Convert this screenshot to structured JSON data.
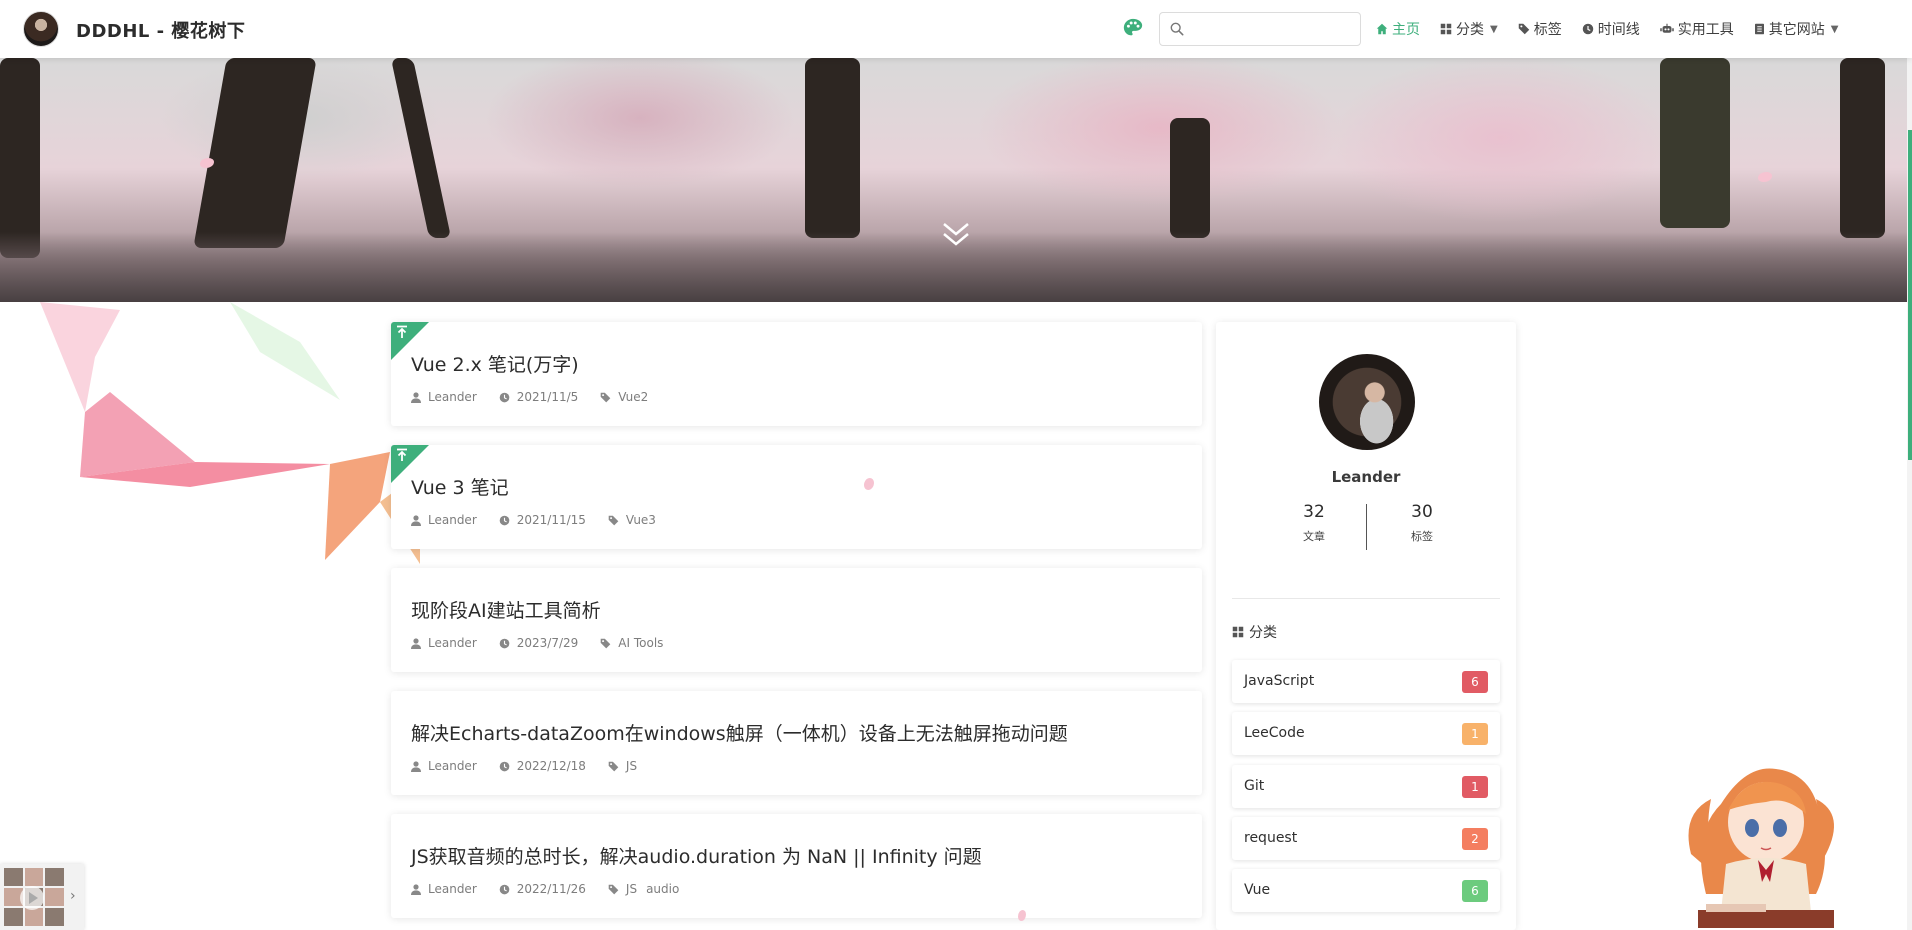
{
  "header": {
    "site_title": "DDDHL - 樱花树下",
    "search": {
      "value": "",
      "placeholder": ""
    },
    "nav": [
      {
        "label": "主页",
        "icon": "home-icon",
        "active": true
      },
      {
        "label": "分类",
        "icon": "grid-icon",
        "has_dropdown": true
      },
      {
        "label": "标签",
        "icon": "tag-icon"
      },
      {
        "label": "时间线",
        "icon": "clock-icon"
      },
      {
        "label": "实用工具",
        "icon": "robot-icon"
      },
      {
        "label": "其它网站",
        "icon": "book-icon",
        "has_dropdown": true
      }
    ]
  },
  "posts": [
    {
      "title": "Vue 2.x 笔记(万字)",
      "author": "Leander",
      "date": "2021/11/5",
      "tags": [
        "Vue2"
      ],
      "sticky": true
    },
    {
      "title": "Vue 3 笔记",
      "author": "Leander",
      "date": "2021/11/15",
      "tags": [
        "Vue3"
      ],
      "sticky": true
    },
    {
      "title": "现阶段AI建站工具简析",
      "author": "Leander",
      "date": "2023/7/29",
      "tags": [
        "AI Tools"
      ],
      "sticky": false
    },
    {
      "title": "解决Echarts-dataZoom在windows触屏（一体机）设备上无法触屏拖动问题",
      "author": "Leander",
      "date": "2022/12/18",
      "tags": [
        "JS"
      ],
      "sticky": false
    },
    {
      "title": "JS获取音频的总时长，解决audio.duration 为 NaN || Infinity 问题",
      "author": "Leander",
      "date": "2022/11/26",
      "tags": [
        "JS",
        "audio"
      ],
      "sticky": false
    }
  ],
  "sidebar": {
    "name": "Leander",
    "stats": [
      {
        "value": "32",
        "label": "文章"
      },
      {
        "value": "30",
        "label": "标签"
      }
    ],
    "categories_title": "分类",
    "categories": [
      {
        "name": "JavaScript",
        "count": "6",
        "color": "#e15b64"
      },
      {
        "name": "LeeCode",
        "count": "1",
        "color": "#f8b26a"
      },
      {
        "name": "Git",
        "count": "1",
        "color": "#e15b64"
      },
      {
        "name": "request",
        "count": "2",
        "color": "#f47e60"
      },
      {
        "name": "Vue",
        "count": "6",
        "color": "#6ccb7e"
      }
    ]
  },
  "colors": {
    "accent": "#3eaf7c"
  }
}
